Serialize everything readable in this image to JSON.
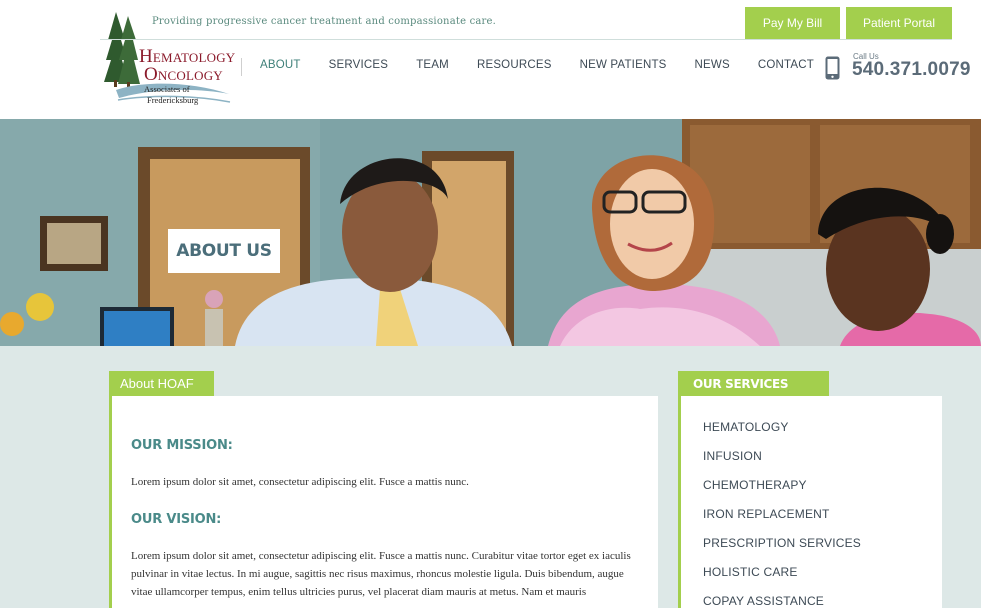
{
  "header": {
    "tagline": "Providing progressive cancer treatment and compassionate care.",
    "logo": {
      "line1": "Hematology",
      "line2": "Oncology",
      "line3": "Associates of",
      "line4": "Fredericksburg"
    },
    "nav": [
      {
        "label": "ABOUT",
        "active": true
      },
      {
        "label": "SERVICES",
        "active": false
      },
      {
        "label": "TEAM",
        "active": false
      },
      {
        "label": "RESOURCES",
        "active": false
      },
      {
        "label": "NEW PATIENTS",
        "active": false
      },
      {
        "label": "NEWS",
        "active": false
      },
      {
        "label": "CONTACT",
        "active": false
      }
    ],
    "buttons": {
      "pay_bill": "Pay My Bill",
      "patient_portal": "Patient Portal"
    },
    "phone": {
      "call_label": "Call Us",
      "number": "540.371.0079"
    }
  },
  "hero": {
    "title": "ABOUT US"
  },
  "about": {
    "tab_label": "About HOAF",
    "mission_heading": "OUR MISSION:",
    "mission_text": "Lorem ipsum dolor sit amet, consectetur adipiscing elit. Fusce a mattis nunc.",
    "vision_heading": "OUR VISION:",
    "vision_text": "Lorem ipsum dolor sit amet, consectetur adipiscing elit. Fusce a mattis nunc. Curabitur vitae tortor eget ex iaculis pulvinar in vitae lectus. In mi augue, sagittis nec risus maximus, rhoncus molestie ligula. Duis bibendum, augue vitae ullamcorper tempus, enim tellus ultricies purus, vel placerat diam mauris at metus. Nam et mauris"
  },
  "services": {
    "tab_label": "OUR SERVICES",
    "items": [
      "HEMATOLOGY",
      "INFUSION",
      "CHEMOTHERAPY",
      "IRON REPLACEMENT",
      "PRESCRIPTION SERVICES",
      "HOLISTIC CARE",
      "COPAY ASSISTANCE"
    ]
  },
  "colors": {
    "accent_green": "#a3cf4d",
    "teal_text": "#4a8a89",
    "logo_red": "#8b1a2b",
    "page_bg": "#dde8e7"
  },
  "icons": [
    "pine-trees-logo-icon",
    "mobile-phone-icon"
  ]
}
